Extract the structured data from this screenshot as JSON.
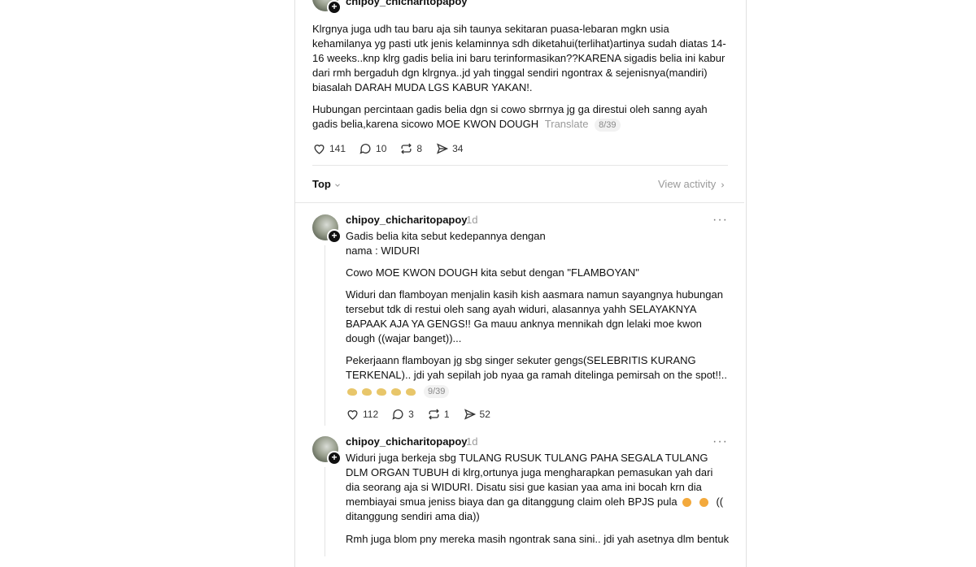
{
  "post": {
    "username": "chipoy_chicharitopapoy",
    "time": "1d",
    "paragraphs": [
      "Klrgnya juga udh tau baru aja sih taunya sekitaran puasa-lebaran mgkn usia kehamilanya yg pasti utk jenis kelaminnya sdh diketahui(terlihat)artinya sudah diatas 14-16 weeks..knp klrg gadis belia ini baru terinformasikan??KARENA sigadis belia ini kabur dari rmh bergaduh dgn klrgnya..jd yah tinggal sendiri ngontrax & sejenisnya(mandiri) biasalah DARAH MUDA LGS KABUR YAKAN!.",
      "Hubungan percintaan gadis belia dgn si cowo sbrrnya jg ga direstui oleh sanng ayah gadis belia,karena sicowo MOE KWON DOUGH"
    ],
    "translate_label": "Translate",
    "counter": "8/39",
    "likes": "141",
    "replies": "10",
    "reposts": "8",
    "shares": "34"
  },
  "sort": {
    "label": "Top",
    "view_activity": "View activity"
  },
  "reply1": {
    "username": "chipoy_chicharitopapoy",
    "time": "1d",
    "line1": "Gadis belia kita sebut kedepannya dengan",
    "line2": "nama : WIDURI",
    "paragraphs": [
      "Cowo MOE KWON DOUGH kita sebut dengan \"FLAMBOYAN\"",
      "Widuri dan flamboyan menjalin kasih kish aasmara namun sayangnya hubungan tersebut tdk di restui oleh sang ayah widuri, alasannya yahh SELAYAKNYA BAPAAK AJA YA GENGS!! Ga mauu anknya mennikah dgn lelaki moe kwon dough ((wajar banget))...",
      "Pekerjaann flamboyan jg sbg singer sekuter gengs(SELEBRITIS KURANG TERKENAL).. jdi yah sepilah job nyaa ga ramah ditelinga pemirsah on the spot!!.."
    ],
    "emoji_icon": "clapping-hands-emoji",
    "counter": "9/39",
    "likes": "112",
    "replies": "3",
    "reposts": "1",
    "shares": "52"
  },
  "reply2": {
    "username": "chipoy_chicharitopapoy",
    "time": "1d",
    "para1": "Widuri juga berkeja sbg TULANG RUSUK TULANG PAHA SEGALA TULANG DLM ORGAN TUBUH di klrg,ortunya juga mengharapkan pemasukan yah dari dia seorang aja si WIDURI. Disatu sisi gue kasian yaa ama ini bocah krn dia membiayai smua jeniss biaya dan ga ditanggung claim oleh BPJS pula",
    "para1_tail": "((  ditanggung sendiri ama dia))",
    "emoji_icon": "hot-face-emoji",
    "para2": "Rmh juga blom pny mereka masih ngontrak sana sini.. jdi yah asetnya dlm bentuk"
  },
  "colors": {
    "text": "#101010",
    "muted": "#9a9a9a",
    "border": "#e0e0e0"
  }
}
